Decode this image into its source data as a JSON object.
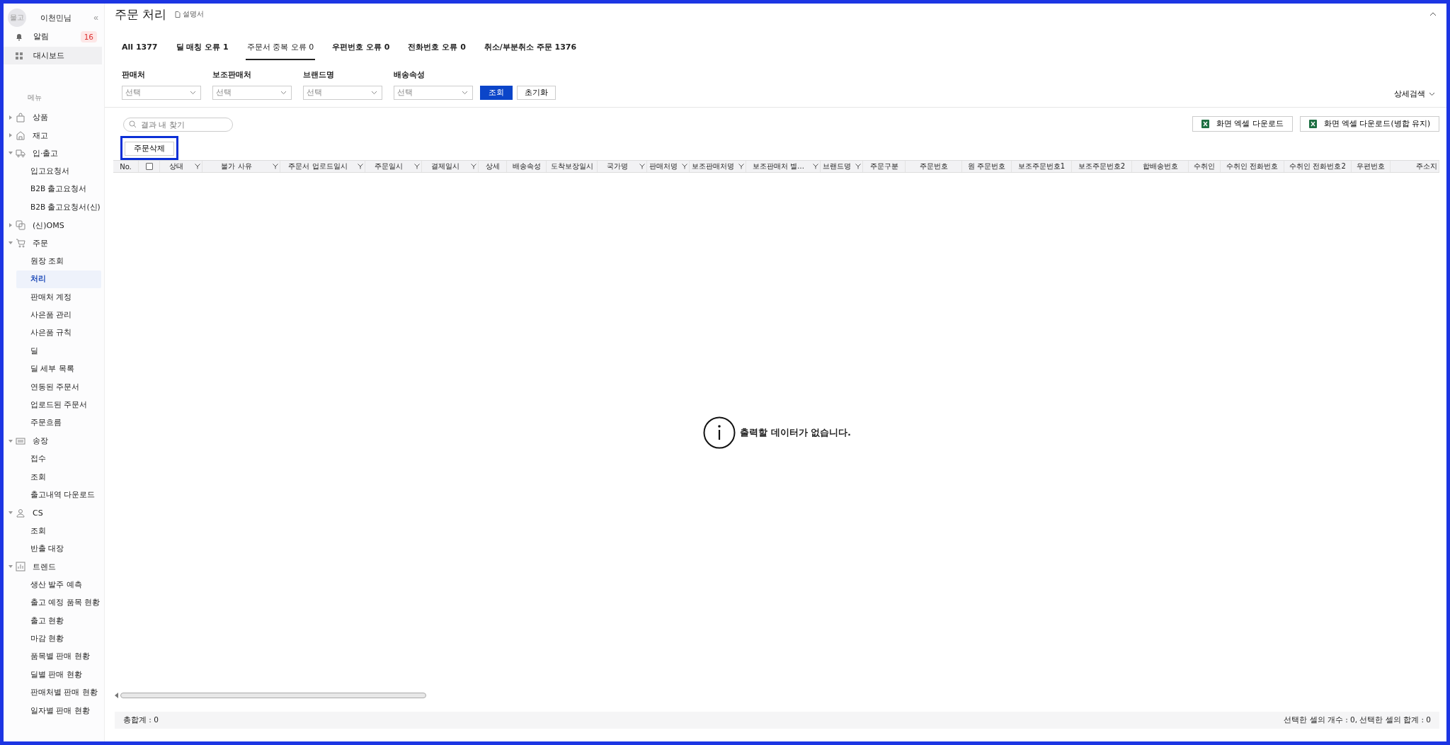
{
  "sidebar": {
    "avatar": "물고",
    "user": "이천민님",
    "collapse": "«",
    "notifications": {
      "label": "알림",
      "count": "16"
    },
    "dashboard": {
      "label": "대시보드",
      "highlighted": true
    },
    "menu_label": "메뉴",
    "menu": [
      {
        "label": "상품",
        "expanded": false
      },
      {
        "label": "재고",
        "expanded": false
      },
      {
        "label": "입·출고",
        "expanded": true,
        "children": [
          {
            "label": "입고요청서",
            "selected": false
          },
          {
            "label": "B2B 출고요청서",
            "selected": false
          },
          {
            "label": "B2B 출고요청서(신)",
            "selected": false
          }
        ]
      },
      {
        "label": "(신)OMS",
        "expanded": false
      },
      {
        "label": "주문",
        "expanded": true,
        "children": [
          {
            "label": "원장 조회",
            "selected": false
          },
          {
            "label": "처리",
            "selected": true
          },
          {
            "label": "판매처 계정",
            "selected": false
          },
          {
            "label": "사은품 관리",
            "selected": false
          },
          {
            "label": "사은품 규칙",
            "selected": false
          },
          {
            "label": "딜",
            "selected": false
          },
          {
            "label": "딜 세부 목록",
            "selected": false
          },
          {
            "label": "연동된 주문서",
            "selected": false
          },
          {
            "label": "업로드된 주문서",
            "selected": false
          },
          {
            "label": "주문흐름",
            "selected": false
          }
        ]
      },
      {
        "label": "송장",
        "expanded": true,
        "children": [
          {
            "label": "접수",
            "selected": false
          },
          {
            "label": "조회",
            "selected": false
          },
          {
            "label": "출고내역 다운로드",
            "selected": false
          }
        ]
      },
      {
        "label": "CS",
        "expanded": true,
        "children": [
          {
            "label": "조회",
            "selected": false
          },
          {
            "label": "반출 대장",
            "selected": false
          }
        ]
      },
      {
        "label": "트렌드",
        "expanded": true,
        "children": [
          {
            "label": "생산 발주 예측",
            "selected": false
          },
          {
            "label": "출고 예정 품목 현황",
            "selected": false
          },
          {
            "label": "출고 현황",
            "selected": false
          },
          {
            "label": "마감 현황",
            "selected": false
          },
          {
            "label": "품목별 판매 현황",
            "selected": false
          },
          {
            "label": "딜별 판매 현황",
            "selected": false
          },
          {
            "label": "판매처별 판매 현황",
            "selected": false
          },
          {
            "label": "일자별 판매 현황",
            "selected": false
          }
        ]
      }
    ]
  },
  "header": {
    "title": "주문 처리",
    "manual": "설명서"
  },
  "tabs": [
    {
      "label": "All 1377",
      "selected": false
    },
    {
      "label": "딜 매칭 오류 1",
      "selected": false
    },
    {
      "label": "주문서 중복 오류 0",
      "selected": true
    },
    {
      "label": "우편번호 오류 0",
      "selected": false
    },
    {
      "label": "전화번호 오류 0",
      "selected": false
    },
    {
      "label": "취소/부분취소 주문 1376",
      "selected": false
    }
  ],
  "filters": [
    {
      "label": "판매처",
      "placeholder": "선택"
    },
    {
      "label": "보조판매처",
      "placeholder": "선택"
    },
    {
      "label": "브랜드명",
      "placeholder": "선택"
    },
    {
      "label": "배송속성",
      "placeholder": "선택"
    }
  ],
  "search_button": "조회",
  "reset_button": "초기화",
  "advanced_search": "상세검색",
  "result_search": {
    "placeholder": "결과 내 찾기"
  },
  "excel_buttons": [
    "화면 엑셀 다운로드",
    "화면 엑셀 다운로드(병합 유지)"
  ],
  "delete_button": {
    "label": "주문삭제",
    "highlighted": true
  },
  "table": {
    "columns": [
      {
        "kind": "text",
        "label": "No.",
        "filter": false
      },
      {
        "kind": "checkbox",
        "checked": false
      },
      {
        "kind": "text",
        "label": "상태",
        "filter": true
      },
      {
        "kind": "text",
        "label": "불가 사유",
        "filter": true
      },
      {
        "kind": "text",
        "label": "주문서 업로드일시",
        "filter": true
      },
      {
        "kind": "text",
        "label": "주문일시",
        "filter": true
      },
      {
        "kind": "text",
        "label": "결제일시",
        "filter": true
      },
      {
        "kind": "text",
        "label": "상세",
        "filter": false
      },
      {
        "kind": "text",
        "label": "배송속성",
        "filter": false
      },
      {
        "kind": "text",
        "label": "도착보장일시",
        "filter": false
      },
      {
        "kind": "text",
        "label": "국가명",
        "filter": true
      },
      {
        "kind": "text",
        "label": "판매처명",
        "filter": true
      },
      {
        "kind": "text",
        "label": "보조판매처명",
        "filter": true
      },
      {
        "kind": "text",
        "label": "보조판매처 별…",
        "filter": true
      },
      {
        "kind": "text",
        "label": "브랜드명",
        "filter": true
      },
      {
        "kind": "text",
        "label": "주문구분",
        "filter": false
      },
      {
        "kind": "text",
        "label": "주문번호",
        "filter": false
      },
      {
        "kind": "text",
        "label": "원 주문번호",
        "filter": false
      },
      {
        "kind": "text",
        "label": "보조주문번호1",
        "filter": false
      },
      {
        "kind": "text",
        "label": "보조주문번호2",
        "filter": false
      },
      {
        "kind": "text",
        "label": "합배송번호",
        "filter": false
      },
      {
        "kind": "text",
        "label": "수취인",
        "filter": false
      },
      {
        "kind": "text",
        "label": "수취인 전화번호",
        "filter": false
      },
      {
        "kind": "text",
        "label": "수취인 전화번호2",
        "filter": false
      },
      {
        "kind": "text",
        "label": "우편번호",
        "filter": false
      },
      {
        "kind": "text",
        "label": "주소지",
        "filter": false
      }
    ],
    "empty_message": "출력할 데이터가 없습니다."
  },
  "footer": {
    "total": "총합계 : 0",
    "selection": "선택한 셀의 개수 : 0, 선택한 셀의 합계 : 0"
  }
}
